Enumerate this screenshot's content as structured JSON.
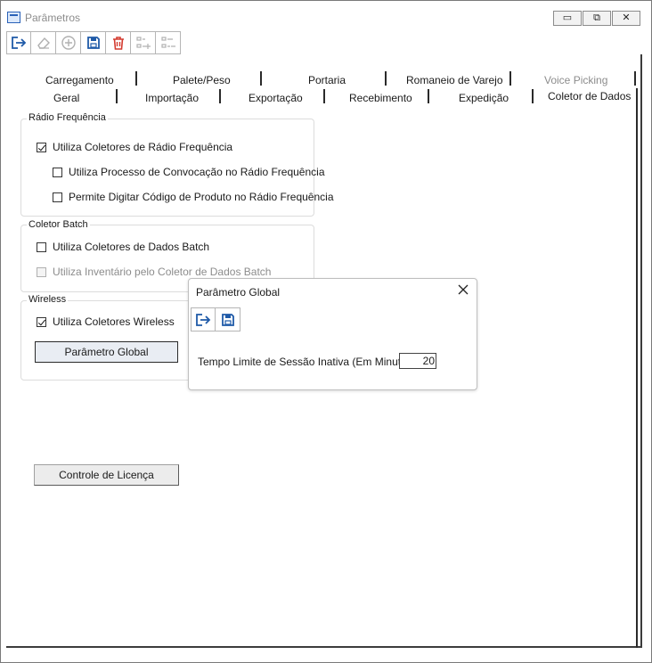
{
  "window": {
    "title": "Parâmetros",
    "controls": {
      "minimize": "▭",
      "maximize": "⧉",
      "close": "✕"
    }
  },
  "toolbar": {
    "icons": [
      "exit-icon",
      "eraser-icon",
      "add-circle-icon",
      "save-icon",
      "delete-icon",
      "add-line-icon",
      "remove-line-icon"
    ]
  },
  "tabs": {
    "row1": [
      "Carregamento",
      "Palete/Peso",
      "Portaria",
      "Romaneio de Varejo",
      "Voice Picking"
    ],
    "row2": [
      "Geral",
      "Importação",
      "Exportação",
      "Recebimento",
      "Expedição",
      "Coletor de Dados"
    ]
  },
  "radio_freq": {
    "title": "Rádio Frequência",
    "use_rf": "Utiliza Coletores de Rádio Frequência",
    "use_convocacao": "Utiliza Processo de Convocação no Rádio Frequência",
    "allow_product_code": "Permite Digitar Código de Produto no Rádio Frequência"
  },
  "batch": {
    "title": "Coletor Batch",
    "use_batch": "Utiliza Coletores de Dados Batch",
    "use_inventory": "Utiliza Inventário pelo Coletor de Dados Batch"
  },
  "wireless": {
    "title": "Wireless",
    "use_wireless": "Utiliza Coletores Wireless",
    "global_button": "Parâmetro Global"
  },
  "license_button": "Controle de Licença",
  "dialog": {
    "title": "Parâmetro Global",
    "close": "✕",
    "label": "Tempo Limite de Sessão Inativa (Em Minutos)",
    "value": "20"
  },
  "colors": {
    "exit": "#1f5aa8",
    "save": "#1f5aa8",
    "delete": "#d43a2f",
    "disabled": "#b0b0b0"
  }
}
